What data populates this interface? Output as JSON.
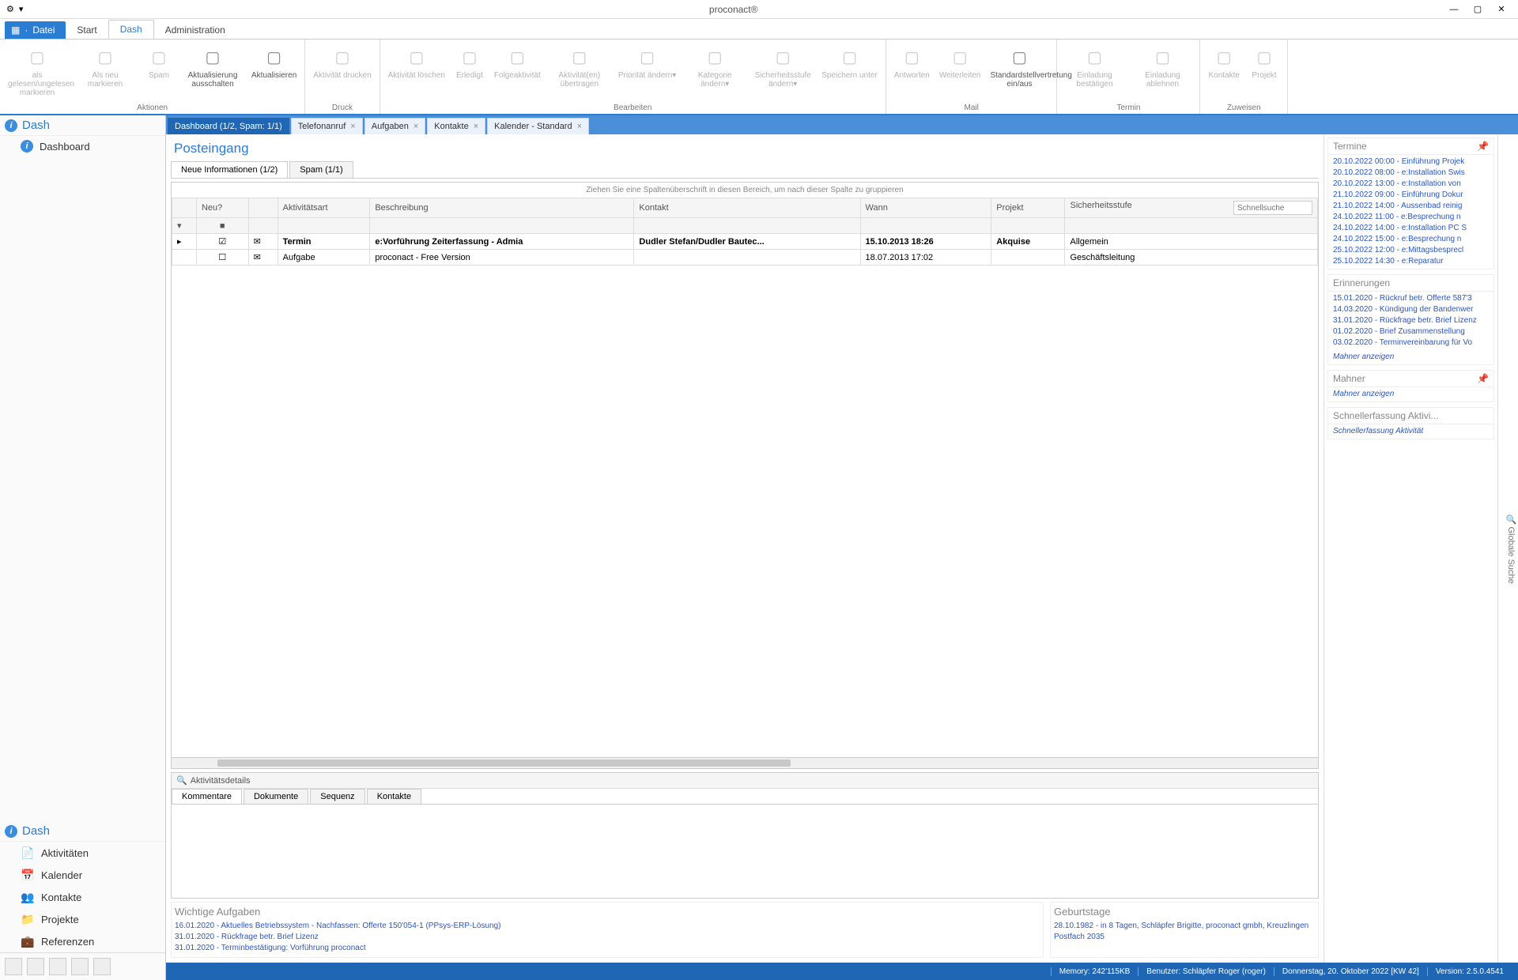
{
  "app_title": "proconact®",
  "file_menu": "Datei",
  "menu_tabs": [
    "Start",
    "Dash",
    "Administration"
  ],
  "menu_active": "Dash",
  "ribbon": {
    "groups": [
      {
        "label": "Aktionen",
        "items": [
          {
            "name": "mark-read",
            "label": "als gelesen/ungelesen markieren",
            "disabled": true
          },
          {
            "name": "mark-new",
            "label": "Als neu markieren",
            "disabled": true
          },
          {
            "name": "spam",
            "label": "Spam",
            "disabled": true
          },
          {
            "name": "autorefresh-off",
            "label": "Aktualisierung ausschalten"
          },
          {
            "name": "refresh",
            "label": "Aktualisieren"
          }
        ]
      },
      {
        "label": "Druck",
        "items": [
          {
            "name": "print-activity",
            "label": "Aktivität drucken",
            "disabled": true
          }
        ]
      },
      {
        "label": "Bearbeiten",
        "items": [
          {
            "name": "delete-activity",
            "label": "Aktivität löschen",
            "disabled": true
          },
          {
            "name": "done",
            "label": "Erledigt",
            "disabled": true
          },
          {
            "name": "followup",
            "label": "Folgeaktivität",
            "disabled": true
          },
          {
            "name": "transfer",
            "label": "Aktivität(en) übertragen",
            "disabled": true
          },
          {
            "name": "priority",
            "label": "Priorität ändern▾",
            "disabled": true
          },
          {
            "name": "category",
            "label": "Kategorie ändern▾",
            "disabled": true
          },
          {
            "name": "security",
            "label": "Sicherheitsstufe ändern▾",
            "disabled": true
          },
          {
            "name": "saveas",
            "label": "Speichern unter",
            "disabled": true
          }
        ]
      },
      {
        "label": "Mail",
        "items": [
          {
            "name": "reply",
            "label": "Antworten",
            "disabled": true
          },
          {
            "name": "forward",
            "label": "Weiterleiten",
            "disabled": true
          },
          {
            "name": "deputy",
            "label": "Standardstellvertretung ein/aus"
          }
        ]
      },
      {
        "label": "Termin",
        "items": [
          {
            "name": "confirm-invite",
            "label": "Einladung bestätigen",
            "disabled": true
          },
          {
            "name": "decline-invite",
            "label": "Einladung ablehnen",
            "disabled": true
          }
        ]
      },
      {
        "label": "Zuweisen",
        "items": [
          {
            "name": "assign-contact",
            "label": "Kontakte",
            "disabled": true
          },
          {
            "name": "assign-project",
            "label": "Projekt",
            "disabled": true
          }
        ]
      }
    ]
  },
  "sidebar": {
    "head1": "Dash",
    "items1": [
      {
        "label": "Dashboard"
      }
    ],
    "head2": "Dash",
    "nav": [
      {
        "label": "Aktivitäten",
        "icon": "📄"
      },
      {
        "label": "Kalender",
        "icon": "📅"
      },
      {
        "label": "Kontakte",
        "icon": "👥"
      },
      {
        "label": "Projekte",
        "icon": "📁"
      },
      {
        "label": "Referenzen",
        "icon": "💼"
      }
    ]
  },
  "doc_tabs": [
    {
      "label": "Dashboard (1/2, Spam: 1/1)",
      "active": true,
      "closeable": false
    },
    {
      "label": "Telefonanruf",
      "closeable": true
    },
    {
      "label": "Aufgaben",
      "closeable": true
    },
    {
      "label": "Kontakte",
      "closeable": true
    },
    {
      "label": "Kalender - Standard",
      "closeable": true
    }
  ],
  "inbox": {
    "title": "Posteingang",
    "subtabs": [
      {
        "label": "Neue Informationen (1/2)",
        "active": true
      },
      {
        "label": "Spam (1/1)"
      }
    ],
    "group_hint": "Ziehen Sie eine Spaltenüberschrift in diesen Bereich, um nach dieser Spalte zu gruppieren",
    "columns": [
      "",
      "Neu?",
      "",
      "Aktivitätsart",
      "Beschreibung",
      "Kontakt",
      "Wann",
      "Projekt",
      "Sicherheitsstufe"
    ],
    "quicksearch_placeholder": "Schnellsuche",
    "rows": [
      {
        "neu": true,
        "icon": "✉",
        "art": "Termin",
        "beschr": "e:Vorführung Zeiterfassung - Admia",
        "kontakt": "Dudler Stefan/Dudler Bautec...",
        "wann": "15.10.2013 18:26",
        "projekt": "Akquise",
        "stufe": "Allgemein",
        "bold": true
      },
      {
        "neu": false,
        "icon": "✉",
        "art": "Aufgabe",
        "beschr": "proconact - Free Version",
        "kontakt": "",
        "wann": "18.07.2013 17:02",
        "projekt": "",
        "stufe": "Geschäftsleitung"
      }
    ]
  },
  "details": {
    "title": "Aktivitätsdetails",
    "tabs": [
      "Kommentare",
      "Dokumente",
      "Sequenz",
      "Kontakte"
    ]
  },
  "important_tasks": {
    "title": "Wichtige Aufgaben",
    "items": [
      "16.01.2020 - Aktuelles Betriebssystem - Nachfassen: Offerte 150'054-1 (PPsys-ERP-Lösung)",
      "31.01.2020 - Rückfrage betr. Brief Lizenz",
      "31.01.2020 - Terminbestätigung: Vorführung proconact"
    ]
  },
  "birthdays": {
    "title": "Geburtstage",
    "items": [
      "28.10.1982 - in 8 Tagen, Schläpfer Brigitte, proconact gmbh, Kreuzlingen",
      "Postfach 2035"
    ]
  },
  "right": {
    "termine": {
      "title": "Termine",
      "items": [
        "20.10.2022 00:00 - Einführung Projek",
        "20.10.2022 08:00 - e:Installation Swis",
        "20.10.2022 13:00 - e:Installation von",
        "21.10.2022 09:00 - Einführung Dokur",
        "21.10.2022 14:00 - Aussenbad reinig",
        "24.10.2022 11:00 - e:Besprechung n",
        "24.10.2022 14:00 - e:Installation PC S",
        "24.10.2022 15:00 - e:Besprechung n",
        "25.10.2022 12:00 - e:Mittagsbesprecl",
        "25.10.2022 14:30 - e:Reparatur"
      ]
    },
    "erinnerungen": {
      "title": "Erinnerungen",
      "items": [
        "15.01.2020 - Rückruf betr. Offerte 587'3",
        "14.03.2020 - Kündigung der Bandenwer",
        "31.01.2020 - Rückfrage betr. Brief Lizenz",
        "01.02.2020 - Brief Zusammenstellung",
        "03.02.2020 - Terminvereinbarung für Vo"
      ],
      "footer": "Mahner anzeigen"
    },
    "mahner": {
      "title": "Mahner",
      "footer": "Mahner anzeigen"
    },
    "schnell": {
      "title": "Schnellerfassung Aktivi...",
      "footer": "Schnellerfassung Aktivität"
    }
  },
  "global_search": "Globale Suche",
  "status": {
    "memory": "Memory: 242'115KB",
    "user": "Benutzer: Schläpfer Roger (roger)",
    "date": "Donnerstag, 20. Oktober 2022 [KW 42]",
    "version": "Version: 2.5.0.4541"
  }
}
